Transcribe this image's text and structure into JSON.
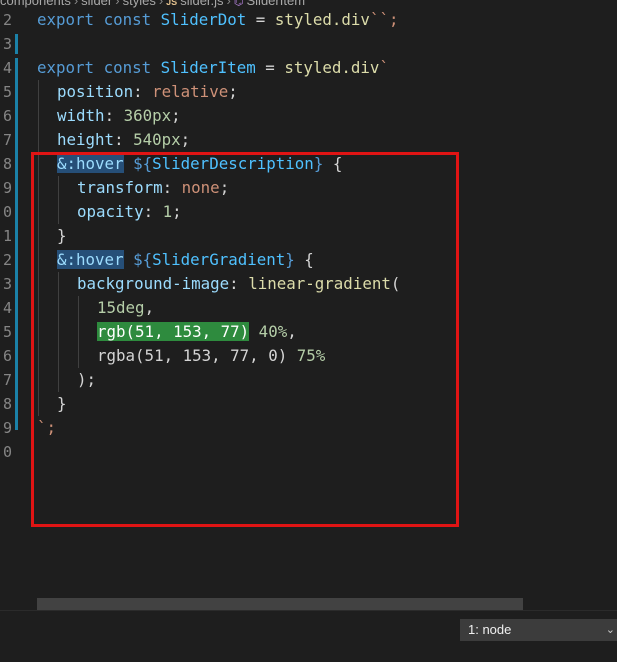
{
  "breadcrumb": {
    "items": [
      "components",
      "slider",
      "styles",
      "slider.js",
      "SliderItem"
    ],
    "separator": "›",
    "file_icon": "JS",
    "symbol_icon": "⌬"
  },
  "gutter": {
    "line_numbers": [
      "2",
      "3",
      "4",
      "5",
      "6",
      "7",
      "8",
      "9",
      "0",
      "1",
      "2",
      "3",
      "4",
      "5",
      "6",
      "7",
      "8",
      "9",
      "0"
    ]
  },
  "code": {
    "l2": {
      "kw1": "export",
      "kw2": "const",
      "name": "SliderDot",
      "eq": "=",
      "fn": "styled.div",
      "tpl": "``;"
    },
    "l4": {
      "kw1": "export",
      "kw2": "const",
      "name": "SliderItem",
      "eq": "=",
      "fn": "styled.div",
      "tpl": "`"
    },
    "l5": {
      "prop": "position",
      "colon": ": ",
      "val": "relative",
      "semi": ";"
    },
    "l6": {
      "prop": "width",
      "colon": ": ",
      "val": "360px",
      "semi": ";"
    },
    "l7": {
      "prop": "height",
      "colon": ": ",
      "val": "540px",
      "semi": ";"
    },
    "l8": {
      "sel": "&:hover",
      "interp_open": " ${",
      "interp": "SliderDescription",
      "interp_close": "}",
      "brace": " {"
    },
    "l9": {
      "prop": "transform",
      "colon": ": ",
      "val": "none",
      "semi": ";"
    },
    "l10": {
      "prop": "opacity",
      "colon": ": ",
      "val": "1",
      "semi": ";"
    },
    "l11": {
      "text": "}"
    },
    "l12": {
      "sel": "&:hover",
      "interp_open": " ${",
      "interp": "SliderGradient",
      "interp_close": "}",
      "brace": " {"
    },
    "l13": {
      "prop": "background-image",
      "colon": ": ",
      "fn": "linear-gradient",
      "paren": "("
    },
    "l14": {
      "val": "15deg",
      "comma": ","
    },
    "l15": {
      "color": "rgb(51, 153, 77)",
      "stop": " 40%",
      "comma": ","
    },
    "l16": {
      "color": "rgba(51, 153, 77, 0)",
      "stop": " 75%"
    },
    "l17": {
      "text": ");"
    },
    "l18": {
      "text": "}"
    },
    "l19": {
      "text": "`;"
    }
  },
  "terminal": {
    "selected": "1: node",
    "chevron": "⌄"
  },
  "colors": {
    "background": "#1e1e1e",
    "annotation_box": "#e01414",
    "highlight_green": "#2e8b3e",
    "selection_blue": "#264f78"
  }
}
